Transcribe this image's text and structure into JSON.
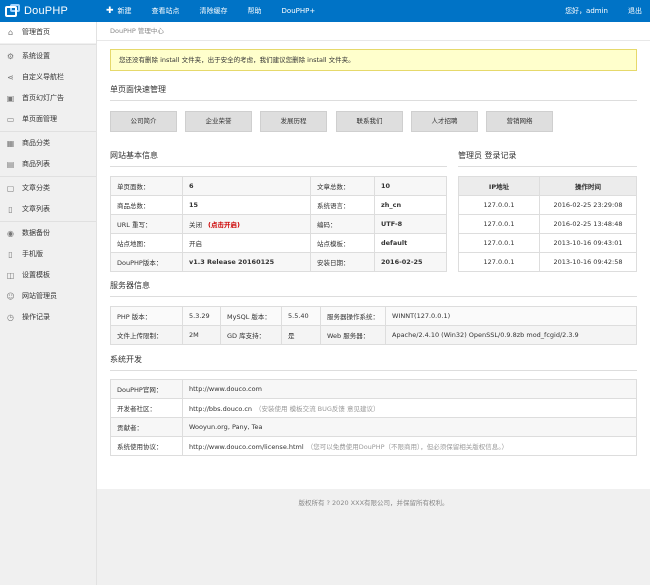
{
  "brand": {
    "name": "DouPHP"
  },
  "topnav": {
    "new_label": "新建",
    "items": [
      "查看站点",
      "清除缓存",
      "帮助",
      "DouPHP+"
    ],
    "greeting": "您好，admin",
    "logout": "退出"
  },
  "sidebar": {
    "items": [
      {
        "label": "管理首页",
        "icon": "home-icon"
      },
      {
        "label": "系统设置",
        "icon": "gear-icon"
      },
      {
        "label": "自定义导航栏",
        "icon": "share-icon"
      },
      {
        "label": "首页幻灯广告",
        "icon": "image-icon"
      },
      {
        "label": "单页面管理",
        "icon": "page-icon"
      },
      {
        "label": "商品分类",
        "icon": "grid-icon"
      },
      {
        "label": "商品列表",
        "icon": "list-icon"
      },
      {
        "label": "文章分类",
        "icon": "folder-icon"
      },
      {
        "label": "文章列表",
        "icon": "document-icon"
      },
      {
        "label": "数据备份",
        "icon": "database-icon"
      },
      {
        "label": "手机版",
        "icon": "mobile-icon"
      },
      {
        "label": "设置模板",
        "icon": "template-icon"
      },
      {
        "label": "网站管理员",
        "icon": "user-icon"
      },
      {
        "label": "操作记录",
        "icon": "clock-icon"
      }
    ]
  },
  "breadcrumb": "DouPHP 管理中心",
  "notice": "您还没有删除 install 文件夹，出于安全的考虑，我们建议您删除 install 文件夹。",
  "quick": {
    "title": "单页面快速管理",
    "buttons": [
      "公司简介",
      "企业荣誉",
      "发展历程",
      "联系我们",
      "人才招聘",
      "营销网络"
    ]
  },
  "site_info": {
    "title": "网站基本信息",
    "rows": [
      {
        "k1": "单页面数：",
        "v1": "6",
        "k2": "文章总数：",
        "v2": "10"
      },
      {
        "k1": "商品总数：",
        "v1": "15",
        "k2": "系统语言：",
        "v2": "zh_cn"
      },
      {
        "k1": "URL 重写：",
        "v1": "关闭",
        "v1_extra": "(点击开启)",
        "k2": "编码：",
        "v2": "UTF-8"
      },
      {
        "k1": "站点地图：",
        "v1": "开启",
        "k2": "站点模板：",
        "v2": "default"
      },
      {
        "k1": "DouPHP版本：",
        "v1": "v1.3 Release 20160125",
        "k2": "安装日期：",
        "v2": "2016-02-25"
      }
    ]
  },
  "login_log": {
    "title": "管理员 登录记录",
    "headers": [
      "IP地址",
      "操作时间"
    ],
    "rows": [
      {
        "ip": "127.0.0.1",
        "time": "2016-02-25 23:29:08"
      },
      {
        "ip": "127.0.0.1",
        "time": "2016-02-25 13:48:48"
      },
      {
        "ip": "127.0.0.1",
        "time": "2013-10-16 09:43:01"
      },
      {
        "ip": "127.0.0.1",
        "time": "2013-10-16 09:42:58"
      }
    ]
  },
  "server": {
    "title": "服务器信息",
    "rows": [
      {
        "k1": "PHP 版本：",
        "v1": "5.3.29",
        "k2": "MySQL 版本：",
        "v2": "5.5.40",
        "k3": "服务器操作系统：",
        "v3": "WINNT(127.0.0.1)"
      },
      {
        "k1": "文件上传限制：",
        "v1": "2M",
        "k2": "GD 库支持：",
        "v2": "是",
        "k3": "Web 服务器：",
        "v3": "Apache/2.4.10 (Win32) OpenSSL/0.9.8zb mod_fcgid/2.3.9"
      }
    ]
  },
  "dev": {
    "title": "系统开发",
    "rows": [
      {
        "k": "DouPHP官网：",
        "v": "http://www.douco.com",
        "extra": ""
      },
      {
        "k": "开发者社区：",
        "v": "http://bbs.douco.cn",
        "extra": "（安装使用 模板交流 BUG反馈 意见建议）"
      },
      {
        "k": "贡献者：",
        "v": "Wooyun.org, Pany, Tea",
        "extra": ""
      },
      {
        "k": "系统使用协议：",
        "v": "http://www.douco.com/license.html",
        "extra": "（您可以免费使用DouPHP（不限商用），但必须保留相关版权信息。）"
      }
    ]
  },
  "footer": "版权所有 ? 2020 XXX有限公司，并保留所有权利。"
}
